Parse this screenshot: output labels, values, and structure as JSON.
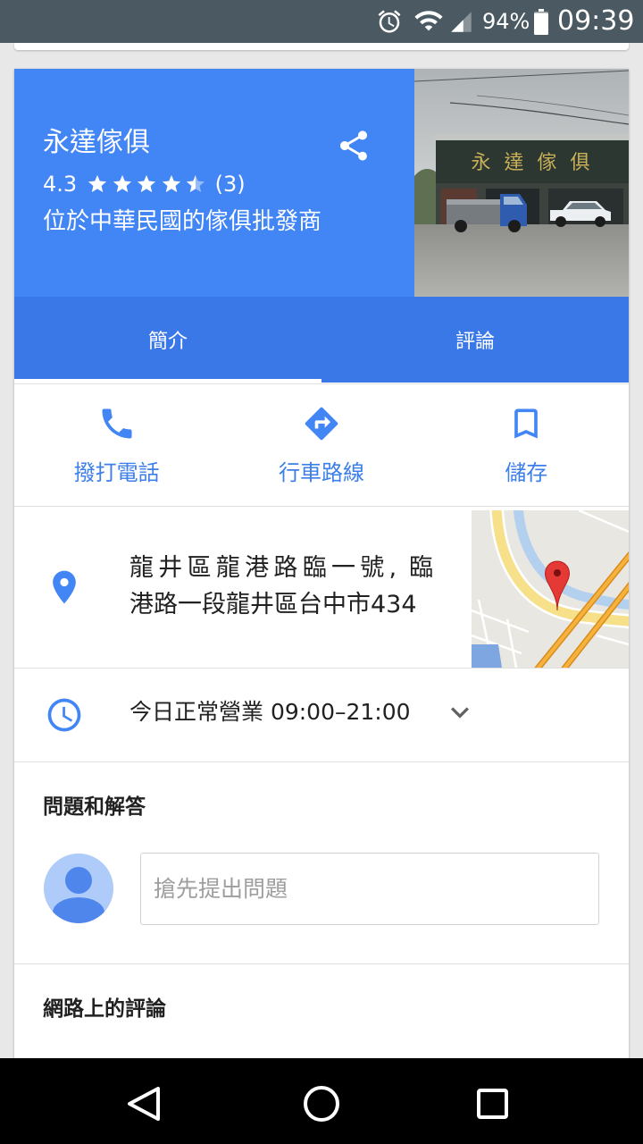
{
  "status_bar": {
    "battery_percent": "94%",
    "time": "09:39",
    "battery_level": 0.94,
    "icons": [
      "alarm-icon",
      "wifi-icon",
      "signal-icon",
      "battery-icon"
    ]
  },
  "place": {
    "name": "永達傢俱",
    "rating": "4.3",
    "star_count": 5,
    "star_fill": 4.5,
    "review_count": "(3)",
    "category": "位於中華民國的傢俱批發商",
    "share_icon": "share-icon"
  },
  "photo": {
    "sign_text": "永 達 傢 俱"
  },
  "tabs": [
    {
      "label": "簡介",
      "active": true
    },
    {
      "label": "評論",
      "active": false
    }
  ],
  "actions": [
    {
      "label": "撥打電話",
      "icon": "phone-icon"
    },
    {
      "label": "行車路線",
      "icon": "directions-icon"
    },
    {
      "label": "儲存",
      "icon": "bookmark-icon"
    }
  ],
  "address": {
    "lines": [
      "龍井區龍港路臨一號, 臨",
      "港路一段龍井區台中市434"
    ],
    "icon": "place-icon"
  },
  "hours": {
    "text": "今日正常營業 09:00–21:00",
    "icon": "clock-icon",
    "expand_icon": "chevron-down-icon"
  },
  "qa": {
    "title": "問題和解答",
    "placeholder": "搶先提出問題",
    "avatar_icon": "avatar-icon"
  },
  "web_reviews": {
    "title": "網路上的評論"
  },
  "nav_bar": {
    "icons": [
      "back-icon",
      "home-icon",
      "recents-icon"
    ]
  },
  "colors": {
    "page_bg": "#e8e8e8",
    "status_bar": "#4b5a62",
    "header_blue": "#4285f4",
    "tab_bar_blue": "#3b78e7",
    "action_blue": "#4285f4",
    "action_text": "#3d7fe9",
    "divider": "#e0e0e0",
    "text_primary": "#212121",
    "placeholder": "#9e9e9e",
    "nav_bar": "#000000"
  }
}
